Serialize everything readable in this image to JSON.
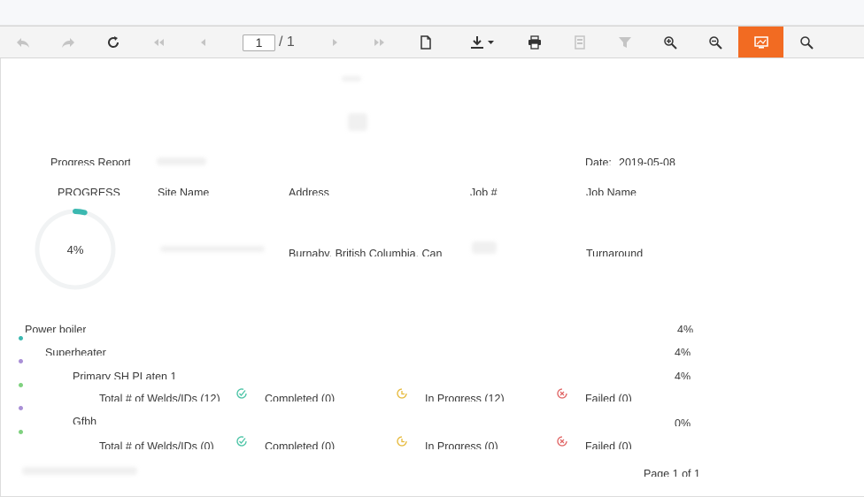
{
  "toolbar": {
    "page_current": "1",
    "page_total": "/ 1",
    "buttons": [
      "undo-icon",
      "redo-icon",
      "refresh-icon",
      "first-page-icon",
      "prev-page-icon",
      "next-page-icon",
      "last-page-icon",
      "document-icon",
      "download-icon",
      "print-icon",
      "layout-icon",
      "filter-icon",
      "zoom-in-icon",
      "zoom-out-icon",
      "presentation-icon",
      "search-icon"
    ],
    "accent_color": "#f26b22"
  },
  "report": {
    "title": "Progress Report",
    "date_label": "Date:",
    "date_value": "2019-05-08",
    "headers": {
      "progress": "PROGRESS",
      "site_name": "Site Name",
      "address": "Address",
      "job_no": "Job #",
      "job_name": "Job Name"
    },
    "progress_percent": "4%",
    "progress_value": 4,
    "address_value": "Burnaby, British Columbia, Can",
    "job_name_value": "Turnaround",
    "gauge_color": "#3bb8b0",
    "rows": [
      {
        "label": "Power boiler",
        "percent": "4%",
        "dot_color": "#3bb8b0"
      },
      {
        "label": "Superheater",
        "percent": "4%",
        "dot_color": "#a98fd6"
      },
      {
        "label": "Primary SH PLaten 1",
        "percent": "4%",
        "dot_color": "#7fd17f"
      },
      {
        "label": "Gfbh",
        "percent": "0%",
        "dot_color": "#a98fd6"
      }
    ],
    "weld_summaries": [
      {
        "total": "Total # of Welds/IDs (12)",
        "completed": "Completed (0)",
        "in_progress": "In Progress (12)",
        "failed": "Failed (0)",
        "dot_color": "#7fd17f"
      },
      {
        "total": "Total # of Welds/IDs (0)",
        "completed": "Completed (0)",
        "in_progress": "In Progress (0)",
        "failed": "Failed (0)",
        "dot_color": "#7fd17f"
      }
    ],
    "footer_page": "Page 1 of 1"
  }
}
